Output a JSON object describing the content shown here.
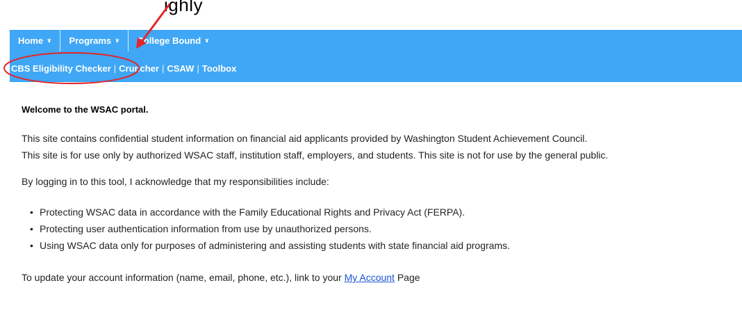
{
  "nav": {
    "items": [
      {
        "label": "Home"
      },
      {
        "label": "Programs"
      },
      {
        "label": "College Bound"
      }
    ],
    "caret_icon": "chevron-down-icon",
    "subitems": [
      {
        "label": "CBS Eligibility Checker"
      },
      {
        "label": "Cruncher"
      },
      {
        "label": "CSAW"
      },
      {
        "label": "Toolbox"
      }
    ],
    "separator": "|",
    "background": "#3fa7f5"
  },
  "content": {
    "welcome": "Welcome to the WSAC portal.",
    "intro_lines": [
      "This site contains confidential student information on financial aid applicants provided by Washington Student Achievement Council.",
      "This site is for use only by authorized WSAC staff, institution staff, employers, and students. This site is not for use by the general public."
    ],
    "acknowledge": "By logging in to this tool, I acknowledge that my responsibilities include:",
    "bullets": [
      "Protecting WSAC data in accordance with the Family Educational Rights and Privacy Act (FERPA).",
      "Protecting user authentication information from use by unauthorized persons.",
      "Using WSAC data only for purposes of administering and assisting students with state financial aid programs."
    ],
    "account_prefix": "To update your account information (name, email, phone, etc.), link to your ",
    "account_link": "My Account",
    "account_suffix": " Page"
  },
  "annotation": {
    "label_fragment": "ighly",
    "color": "#e3262a"
  }
}
